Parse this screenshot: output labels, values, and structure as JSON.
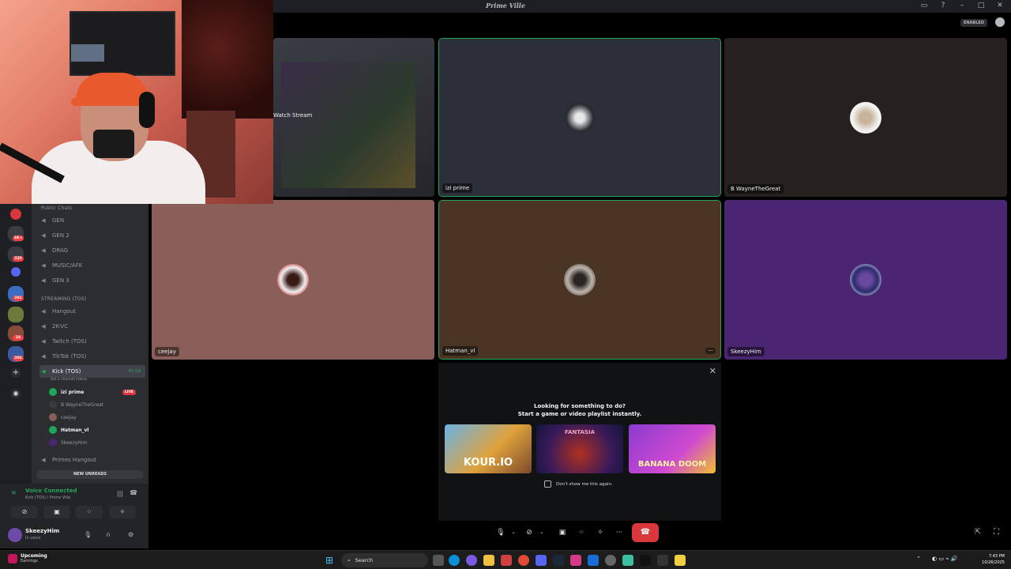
{
  "window": {
    "title": "Prime Ville"
  },
  "topbar": {
    "enabled_badge": "ENABLED"
  },
  "sidebar": {
    "categories": {
      "public": "Public Chats",
      "streaming": "STREAMING (TOS)"
    },
    "public_channels": [
      "GEN",
      "GEN 2",
      "DRAG",
      "MUSIC/AFK",
      "GEN 3"
    ],
    "streaming_channels": [
      "Hangout",
      "2K-VC",
      "Twitch (TOS)",
      "TikTok (TOS)"
    ],
    "active_channel": {
      "label": "Kick (TOS)",
      "time": "4h:18",
      "status": "Set a channel status"
    },
    "members": [
      {
        "name": "izi prime",
        "badge": "LIVE"
      },
      {
        "name": "B WayneTheGreat"
      },
      {
        "name": "ceejay"
      },
      {
        "name": "Hatman_vl"
      },
      {
        "name": "SkeezyHim"
      }
    ],
    "extra_channel": "Primes Hangout",
    "new_unreads": "NEW UNREADS"
  },
  "servers": {
    "badges": [
      "1K+",
      "335",
      "201",
      "24",
      "204"
    ]
  },
  "voice_panel": {
    "status": "Voice Connected",
    "location": "Kick (TOS) / Prime Ville"
  },
  "user_panel": {
    "name": "SkeezyHim",
    "status": "In voice"
  },
  "stream_tile": {
    "label": "Watch Stream"
  },
  "tiles": [
    "izi prime",
    "B WayneTheGreat",
    "ceejay",
    "Hatman_vl",
    "SkeezyHim"
  ],
  "activity": {
    "line1": "Looking for something to do?",
    "line2": "Start a game or video playlist instantly.",
    "games": [
      "KOUR.IO",
      "FANTASIA",
      "BANANA DOOM"
    ],
    "dont_show": "Don't show me this again."
  },
  "taskbar": {
    "notif_title": "Upcoming",
    "notif_sub": "Earnings",
    "search": "Search",
    "time": "7:43 PM",
    "date": "10/26/2025"
  },
  "colors": {
    "speaking": "#23a559",
    "hangup": "#da373c",
    "accent": "#5865f2"
  }
}
